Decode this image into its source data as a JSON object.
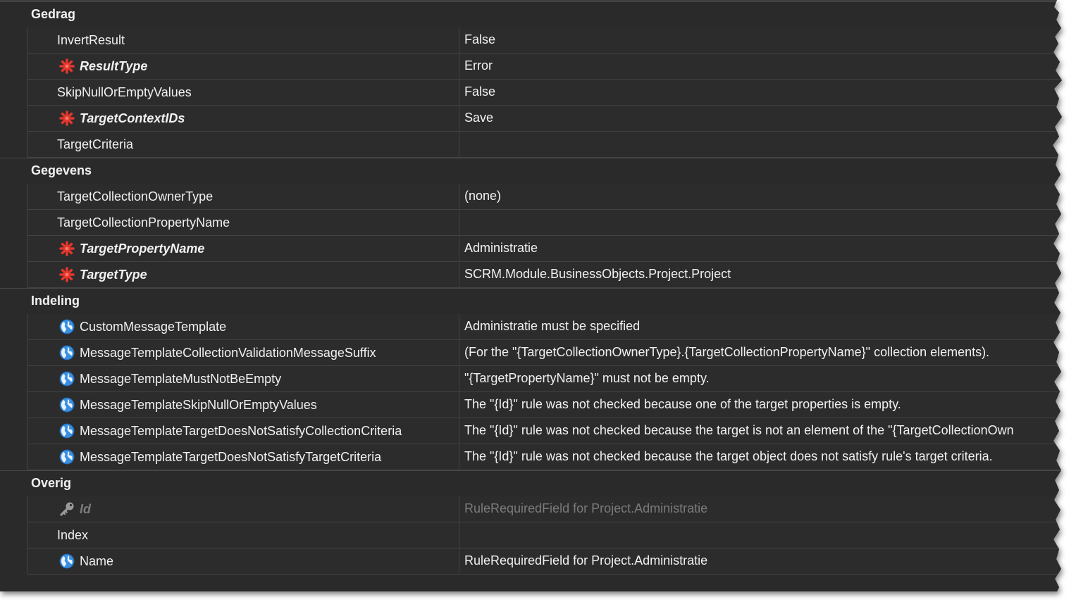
{
  "grid": {
    "categories": [
      {
        "label": "Gedrag",
        "rows": [
          {
            "name": "InvertResult",
            "value": "False"
          },
          {
            "name": "ResultType",
            "value": "Error",
            "icon": "required-asterisk-icon"
          },
          {
            "name": "SkipNullOrEmptyValues",
            "value": "False"
          },
          {
            "name": "TargetContextIDs",
            "value": "Save",
            "icon": "required-asterisk-icon"
          },
          {
            "name": "TargetCriteria",
            "value": ""
          }
        ]
      },
      {
        "label": "Gegevens",
        "rows": [
          {
            "name": "TargetCollectionOwnerType",
            "value": "(none)"
          },
          {
            "name": "TargetCollectionPropertyName",
            "value": ""
          },
          {
            "name": "TargetPropertyName",
            "value": "Administratie",
            "icon": "required-asterisk-icon"
          },
          {
            "name": "TargetType",
            "value": "SCRM.Module.BusinessObjects.Project.Project",
            "icon": "required-asterisk-icon"
          }
        ]
      },
      {
        "label": "Indeling",
        "rows": [
          {
            "name": "CustomMessageTemplate",
            "value": "Administratie must be specified",
            "icon": "globe-icon"
          },
          {
            "name": "MessageTemplateCollectionValidationMessageSuffix",
            "value": "(For the \"{TargetCollectionOwnerType}.{TargetCollectionPropertyName}\" collection elements).",
            "icon": "globe-icon"
          },
          {
            "name": "MessageTemplateMustNotBeEmpty",
            "value": "\"{TargetPropertyName}\" must not be empty.",
            "icon": "globe-icon"
          },
          {
            "name": "MessageTemplateSkipNullOrEmptyValues",
            "value": "The \"{Id}\" rule was not checked because one of the target properties is empty.",
            "icon": "globe-icon"
          },
          {
            "name": "MessageTemplateTargetDoesNotSatisfyCollectionCriteria",
            "value": "The \"{Id}\" rule was not checked because the target is not an element of the \"{TargetCollectionOwn",
            "icon": "globe-icon"
          },
          {
            "name": "MessageTemplateTargetDoesNotSatisfyTargetCriteria",
            "value": "The \"{Id}\" rule was not checked because the target object does not satisfy rule's target criteria.",
            "icon": "globe-icon"
          }
        ]
      },
      {
        "label": "Overig",
        "rows": [
          {
            "name": "Id",
            "value": "RuleRequiredField for Project.Administratie",
            "icon": "key-icon"
          },
          {
            "name": "Index",
            "value": ""
          },
          {
            "name": "Name",
            "value": "RuleRequiredField for Project.Administratie",
            "icon": "globe-icon"
          }
        ]
      }
    ]
  },
  "colors": {
    "panel_bg": "#2a2a2a",
    "cell_bg": "#2c2c2c",
    "text": "#f1f1f1",
    "disabled_text": "#7b7b7b",
    "required_icon": "#e5362b",
    "globe_icon": "#3a8ee0"
  }
}
